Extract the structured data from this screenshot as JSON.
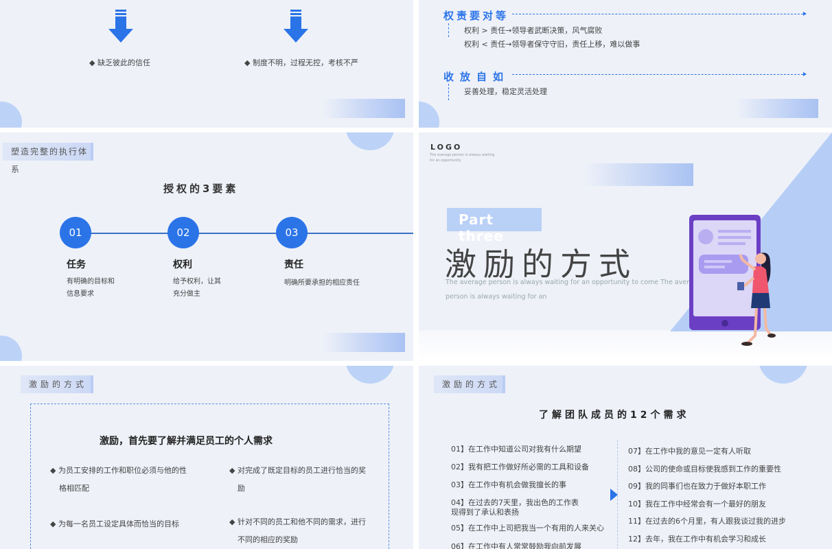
{
  "s1": {
    "item_left": "◆ 缺乏彼此的信任",
    "item_right": "◆ 制度不明，过程无控，考核不严"
  },
  "s2": {
    "h1": "权责要对等",
    "l1": "权利 > 责任→领导者武断决策，风气腐败",
    "l2": "权利 < 责任→领导者保守守旧，责任上移，难以做事",
    "h2": "收放自如",
    "l3": "妥善处理，稳定灵活处理"
  },
  "s3": {
    "tag": "塑造完整的执行体系",
    "title": "授权的3要素",
    "steps": [
      {
        "num": "01",
        "title": "任务",
        "desc1": "有明确的目标和",
        "desc2": "信息要求"
      },
      {
        "num": "02",
        "title": "权利",
        "desc1": "给予权利，让其",
        "desc2": "充分做主"
      },
      {
        "num": "03",
        "title": "责任",
        "desc1": "明确所要承担的相应责任",
        "desc2": ""
      }
    ]
  },
  "s4": {
    "logo": "LOGO",
    "logo_sub1": "The average person is always waiting",
    "logo_sub2": "for an opportunity",
    "part": "Part three",
    "title": "激励的方式",
    "sub1": "The average person is always waiting for an opportunity to come The average",
    "sub2": "person is always waiting for an"
  },
  "s5": {
    "tag": "激励的方式",
    "title": "激励，首先要了解并满足员工的个人需求",
    "b1a": "◆ 为员工安排的工作和职位必须与他的性",
    "b1b": "格相匹配",
    "b2a": "◆ 对完成了既定目标的员工进行恰当的奖",
    "b2b": "励",
    "b3a": "◆ 为每一名员工设定具体而恰当的目标",
    "b4a": "◆ 针对不同的员工和他不同的需求，进行",
    "b4b": "不同的相应的奖励"
  },
  "s6": {
    "tag": "激励的方式",
    "title": "了解团队成员的12个需求",
    "left": [
      "01】在工作中知道公司对我有什么期望",
      "02】我有把工作做好所必需的工具和设备",
      "03】在工作中有机会做我擅长的事",
      "04】在过去的7天里，我出色的工作表",
      "现得到了承认和表扬",
      "05】在工作中上司把我当一个有用的人来关心",
      "06】在工作中有人常常鼓励我向前发展"
    ],
    "right": [
      "07】在工作中我的意见一定有人听取",
      "08】公司的使命或目标使我感到工作的重要性",
      "09】我的同事们也在致力于做好本职工作",
      "10】我在工作中经常会有一个最好的朋友",
      "11】在过去的6个月里，有人跟我谈过我的进步",
      "12】去年，我在工作中有机会学习和成长"
    ]
  }
}
